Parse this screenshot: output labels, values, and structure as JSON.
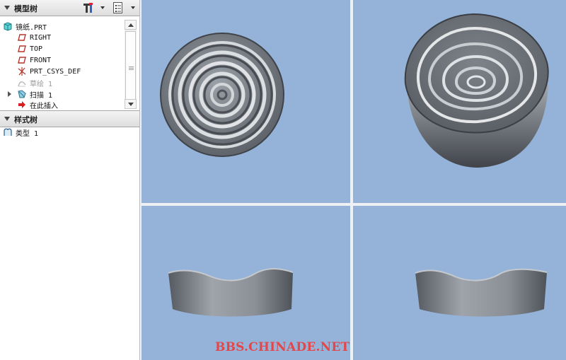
{
  "model_tree": {
    "title": "模型树",
    "root": "镜纸.PRT",
    "items": [
      {
        "label": "RIGHT",
        "icon": "datum-plane-icon"
      },
      {
        "label": "TOP",
        "icon": "datum-plane-icon"
      },
      {
        "label": "FRONT",
        "icon": "datum-plane-icon"
      },
      {
        "label": "PRT_CSYS_DEF",
        "icon": "coordinate-system-icon"
      },
      {
        "label": "草绘 1",
        "icon": "sketch-icon",
        "state": "suppressed"
      },
      {
        "label": "扫描 1",
        "icon": "sweep-feature-icon"
      },
      {
        "label": "在此插入",
        "icon": "insert-here-arrow-icon"
      }
    ]
  },
  "style_tree": {
    "title": "样式树",
    "items": [
      {
        "label": "类型 1",
        "icon": "style-type-icon"
      }
    ]
  },
  "viewports": [
    {
      "name": "top-view"
    },
    {
      "name": "isometric-view"
    },
    {
      "name": "front-view"
    },
    {
      "name": "side-view"
    }
  ],
  "watermark": "BBS.CHINADE.NET",
  "colors": {
    "viewport_bg": "#95b3d9",
    "model_gray": "#8a8f96",
    "watermark": "#e4474a"
  }
}
